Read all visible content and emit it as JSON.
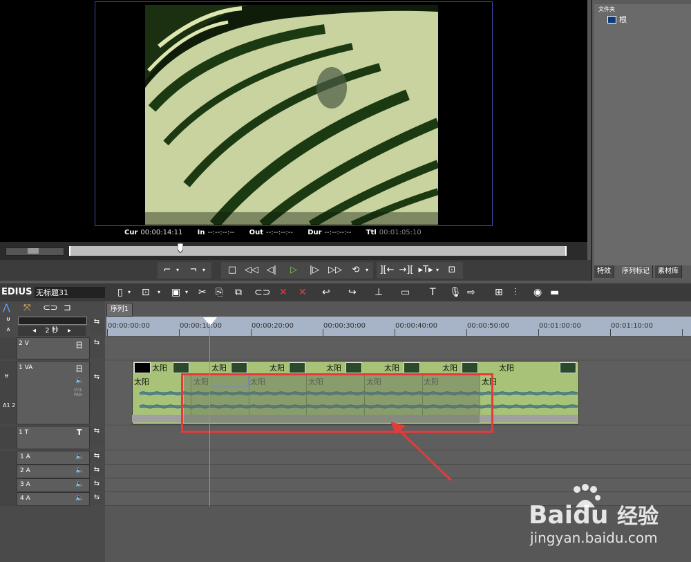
{
  "player": {
    "timecodes": [
      {
        "label": "Cur",
        "value": "00:00:14:11",
        "dim": false
      },
      {
        "label": "In",
        "value": "--:--:--:--",
        "dim": false
      },
      {
        "label": "Out",
        "value": "--:--:--:--",
        "dim": false
      },
      {
        "label": "Dur",
        "value": "--:--:--:--",
        "dim": false
      },
      {
        "label": "Ttl",
        "value": "00:01:05:10",
        "dim": true
      }
    ]
  },
  "bin": {
    "folder_title": "文件夹",
    "root_label": "根",
    "tabs": [
      "特效",
      "序列标记",
      "素材库"
    ]
  },
  "toolbar": {
    "app_name": "EDIUS",
    "project_name": "无标题31"
  },
  "sequence": {
    "tab_label": "序列1",
    "zoom_label": "2 秒",
    "ruler_ticks": [
      "00:00:00:00",
      "00:00:10:00",
      "00:00:20:00",
      "00:00:30:00",
      "00:00:40:00",
      "00:00:50:00",
      "00:01:00:00",
      "00:01:10:00"
    ]
  },
  "tracks": {
    "video2": "2 V",
    "va1": "1 VA",
    "title1": "1 T",
    "audio": [
      "1 A",
      "2 A",
      "3 A",
      "4 A"
    ],
    "vol_label": "VOL PAN",
    "a12_label": "A1\n2",
    "title_icon": "T"
  },
  "clips": {
    "name": "太阳"
  },
  "watermark": {
    "brand": "Bai",
    "brand2": "du",
    "product": "经验",
    "url": "jingyan.baidu.com"
  },
  "colors": {
    "accent_red": "#e53a3a",
    "clip_green": "#a8c278",
    "playhead": "#3ab8c8",
    "play_button": "#7ec850"
  }
}
